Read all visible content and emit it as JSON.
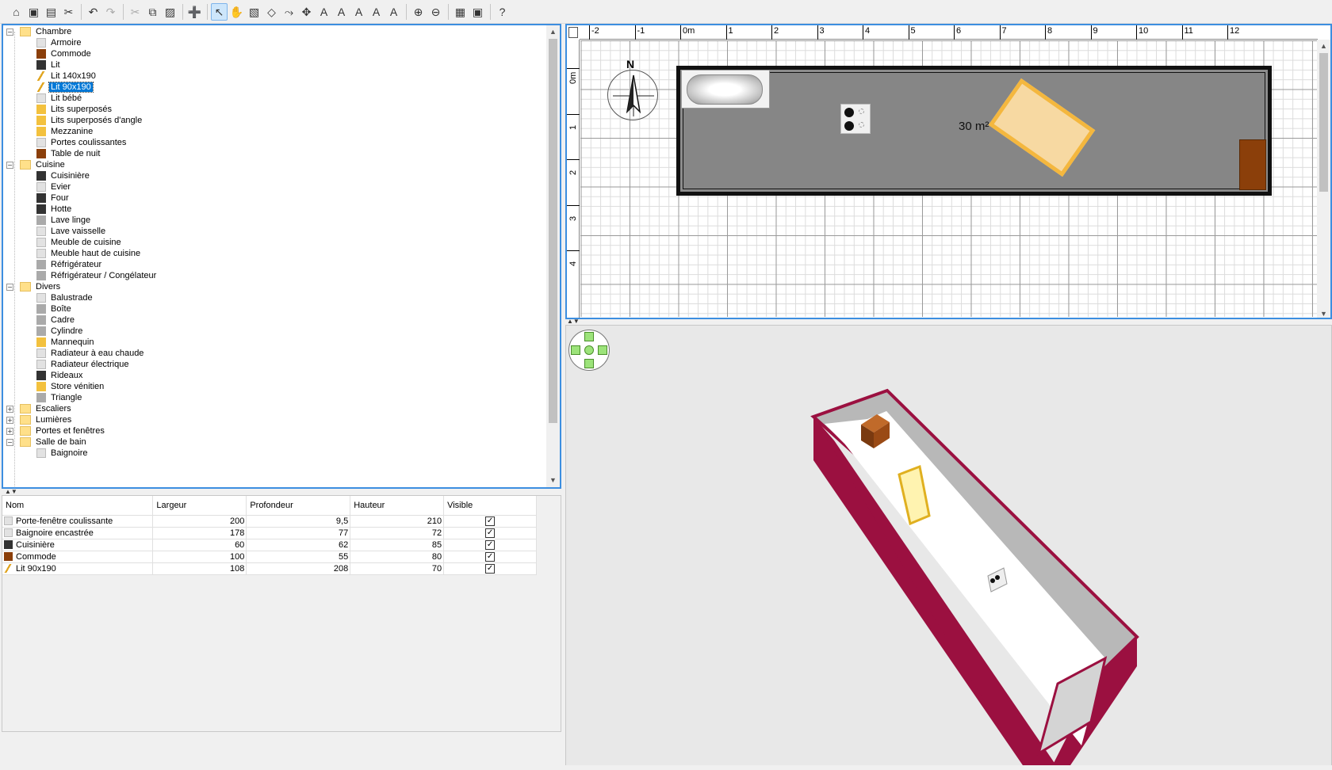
{
  "toolbar": {
    "buttons": [
      {
        "name": "new-home-icon",
        "glyph": "⌂"
      },
      {
        "name": "open-icon",
        "glyph": "▣"
      },
      {
        "name": "save-icon",
        "glyph": "▤"
      },
      {
        "name": "preferences-icon",
        "glyph": "✂"
      },
      {
        "name": "undo-icon",
        "glyph": "↶"
      },
      {
        "name": "redo-icon",
        "glyph": "↷"
      },
      {
        "name": "cut-icon",
        "glyph": "✂"
      },
      {
        "name": "copy-icon",
        "glyph": "⧉"
      },
      {
        "name": "paste-icon",
        "glyph": "▨"
      },
      {
        "name": "add-furniture-icon",
        "glyph": "➕"
      },
      {
        "name": "select-icon",
        "glyph": "↖"
      },
      {
        "name": "pan-icon",
        "glyph": "✋"
      },
      {
        "name": "create-walls-icon",
        "glyph": "▧"
      },
      {
        "name": "create-rooms-icon",
        "glyph": "◇"
      },
      {
        "name": "create-polylines-icon",
        "glyph": "⤳"
      },
      {
        "name": "create-dimensions-icon",
        "glyph": "✥"
      },
      {
        "name": "add-text-icon",
        "glyph": "A"
      },
      {
        "name": "increase-text-size-icon",
        "glyph": "A"
      },
      {
        "name": "decrease-text-size-icon",
        "glyph": "A"
      },
      {
        "name": "bold-text-icon",
        "glyph": "A"
      },
      {
        "name": "italic-text-icon",
        "glyph": "A"
      },
      {
        "name": "zoom-in-icon",
        "glyph": "⊕"
      },
      {
        "name": "zoom-out-icon",
        "glyph": "⊖"
      },
      {
        "name": "create-photo-icon",
        "glyph": "▦"
      },
      {
        "name": "create-video-icon",
        "glyph": "▣"
      },
      {
        "name": "help-icon",
        "glyph": "?"
      }
    ]
  },
  "catalog": {
    "categories": [
      {
        "label": "Chambre",
        "expanded": true,
        "items": [
          {
            "label": "Armoire",
            "icon": "box"
          },
          {
            "label": "Commode",
            "icon": "brown"
          },
          {
            "label": "Lit",
            "icon": "dark"
          },
          {
            "label": "Lit 140x190",
            "icon": "line"
          },
          {
            "label": "Lit 90x190",
            "icon": "line",
            "selected": true
          },
          {
            "label": "Lit bébé",
            "icon": "box"
          },
          {
            "label": "Lits superposés",
            "icon": "yellow"
          },
          {
            "label": "Lits superposés d'angle",
            "icon": "yellow"
          },
          {
            "label": "Mezzanine",
            "icon": "yellow"
          },
          {
            "label": "Portes coulissantes",
            "icon": "box"
          },
          {
            "label": "Table de nuit",
            "icon": "brown"
          }
        ]
      },
      {
        "label": "Cuisine",
        "expanded": true,
        "items": [
          {
            "label": "Cuisinière",
            "icon": "dark"
          },
          {
            "label": "Evier",
            "icon": "box"
          },
          {
            "label": "Four",
            "icon": "dark"
          },
          {
            "label": "Hotte",
            "icon": "dark"
          },
          {
            "label": "Lave linge",
            "icon": "grey"
          },
          {
            "label": "Lave vaisselle",
            "icon": "box"
          },
          {
            "label": "Meuble de cuisine",
            "icon": "box"
          },
          {
            "label": "Meuble haut de cuisine",
            "icon": "box"
          },
          {
            "label": "Réfrigérateur",
            "icon": "grey"
          },
          {
            "label": "Réfrigérateur / Congélateur",
            "icon": "grey"
          }
        ]
      },
      {
        "label": "Divers",
        "expanded": true,
        "items": [
          {
            "label": "Balustrade",
            "icon": "box"
          },
          {
            "label": "Boîte",
            "icon": "grey"
          },
          {
            "label": "Cadre",
            "icon": "grey"
          },
          {
            "label": "Cylindre",
            "icon": "grey"
          },
          {
            "label": "Mannequin",
            "icon": "yellow"
          },
          {
            "label": "Radiateur à eau chaude",
            "icon": "box"
          },
          {
            "label": "Radiateur électrique",
            "icon": "box"
          },
          {
            "label": "Rideaux",
            "icon": "dark"
          },
          {
            "label": "Store vénitien",
            "icon": "yellow"
          },
          {
            "label": "Triangle",
            "icon": "grey"
          }
        ]
      },
      {
        "label": "Escaliers",
        "expanded": false,
        "items": []
      },
      {
        "label": "Lumières",
        "expanded": false,
        "items": []
      },
      {
        "label": "Portes et fenêtres",
        "expanded": false,
        "items": []
      },
      {
        "label": "Salle de bain",
        "expanded": true,
        "items": [
          {
            "label": "Baignoire",
            "icon": "box"
          }
        ]
      }
    ]
  },
  "furniture_table": {
    "columns": [
      "Nom",
      "Largeur",
      "Profondeur",
      "Hauteur",
      "Visible"
    ],
    "rows": [
      {
        "name": "Porte-fenêtre coulissante",
        "icon": "box",
        "width": "200",
        "depth": "9,5",
        "height": "210",
        "visible": true
      },
      {
        "name": "Baignoire encastrée",
        "icon": "box",
        "width": "178",
        "depth": "77",
        "height": "72",
        "visible": true
      },
      {
        "name": "Cuisinière",
        "icon": "dark",
        "width": "60",
        "depth": "62",
        "height": "85",
        "visible": true
      },
      {
        "name": "Commode",
        "icon": "brown",
        "width": "100",
        "depth": "55",
        "height": "80",
        "visible": true
      },
      {
        "name": "Lit 90x190",
        "icon": "line",
        "width": "108",
        "depth": "208",
        "height": "70",
        "visible": true
      }
    ]
  },
  "plan": {
    "ruler_x_labels": [
      "-2",
      "-1",
      "0m",
      "1",
      "2",
      "3",
      "4",
      "5",
      "6",
      "7",
      "8",
      "9",
      "10",
      "11",
      "12"
    ],
    "ruler_y_labels": [
      "0m",
      "1",
      "2",
      "3",
      "4"
    ],
    "area_label": "30 m²",
    "compass_label": "N"
  },
  "view3d": {
    "wall_color": "#9b1040",
    "floor_color": "#ffffff",
    "inner_wall_color": "#b8b8b8"
  }
}
